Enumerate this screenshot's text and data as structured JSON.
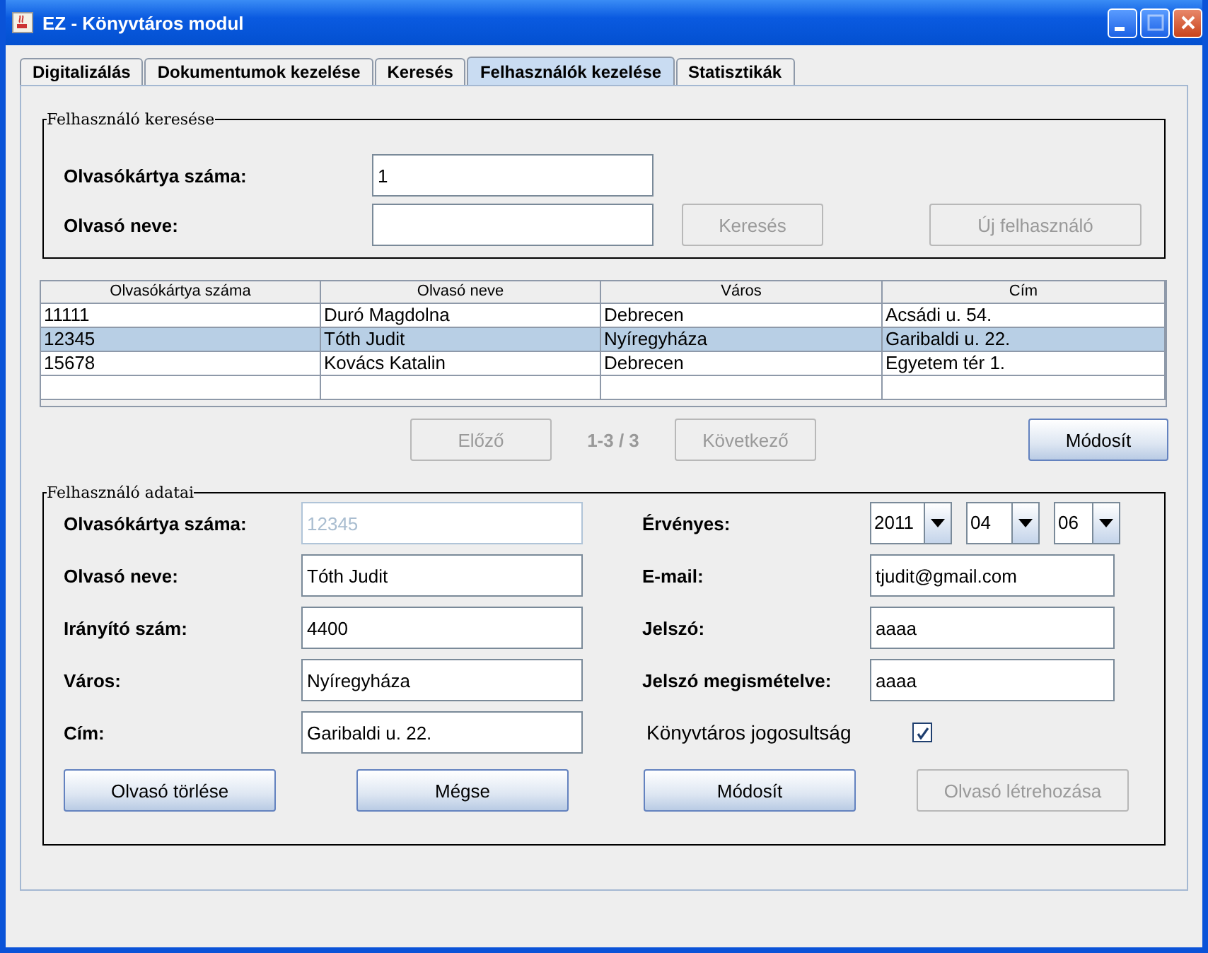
{
  "window": {
    "title": "EZ - Könyvtáros modul"
  },
  "tabs": [
    {
      "label": "Digitalizálás",
      "selected": false
    },
    {
      "label": "Dokumentumok kezelése",
      "selected": false
    },
    {
      "label": "Keresés",
      "selected": false
    },
    {
      "label": "Felhasználók kezelése",
      "selected": true
    },
    {
      "label": "Statisztikák",
      "selected": false
    }
  ],
  "search": {
    "title": "Felhasználó keresése",
    "card_label": "Olvasókártya száma:",
    "card_value": "1",
    "name_label": "Olvasó neve:",
    "buttons": [
      {
        "label": "Keresés",
        "disabled": true
      },
      {
        "label": "Új felhasználó",
        "disabled": true
      }
    ]
  },
  "table": {
    "columns": [
      "Olvasókártya száma",
      "Olvasó neve",
      "Város",
      "Cím"
    ],
    "rows": [
      {
        "cells": [
          "11111",
          "Duró Magdolna",
          "Debrecen",
          "Acsádi u. 54."
        ],
        "selected": false
      },
      {
        "cells": [
          "12345",
          "Tóth Judit",
          "Nyíregyháza",
          "Garibaldi u. 22."
        ],
        "selected": true
      },
      {
        "cells": [
          "15678",
          "Kovács Katalin",
          "Debrecen",
          "Egyetem tér 1."
        ],
        "selected": false
      }
    ]
  },
  "pager": {
    "prev": {
      "label": "Előző",
      "disabled": true
    },
    "info": "1-3 / 3",
    "next": {
      "label": "Következő",
      "disabled": true
    },
    "edit": {
      "label": "Módosít",
      "disabled": false
    }
  },
  "details": {
    "title": "Felhasználó adatai",
    "left": [
      {
        "label": "Olvasókártya száma:",
        "value": "12345",
        "disabled": true
      },
      {
        "label": "Olvasó neve:",
        "value": "Tóth Judit",
        "disabled": false
      },
      {
        "label": "Irányító szám:",
        "value": "4400",
        "disabled": false
      },
      {
        "label": "Város:",
        "value": "Nyíregyháza",
        "disabled": false
      },
      {
        "label": "Cím:",
        "value": "Garibaldi u. 22.",
        "disabled": false
      }
    ],
    "valid_label": "Érvényes:",
    "valid": [
      "2011",
      "04",
      "06"
    ],
    "right": [
      {
        "label": "E-mail:",
        "value": "tjudit@gmail.com"
      },
      {
        "label": "Jelszó:",
        "value": "aaaa"
      },
      {
        "label": "Jelszó megismételve:",
        "value": "aaaa"
      }
    ],
    "permission": {
      "label": "Könyvtáros jogosultság",
      "checked": true
    },
    "buttons": [
      {
        "label": "Olvasó törlése",
        "disabled": false
      },
      {
        "label": "Mégse",
        "disabled": false
      },
      {
        "label": "Módosít",
        "disabled": false
      },
      {
        "label": "Olvasó létrehozása",
        "disabled": true
      }
    ]
  }
}
